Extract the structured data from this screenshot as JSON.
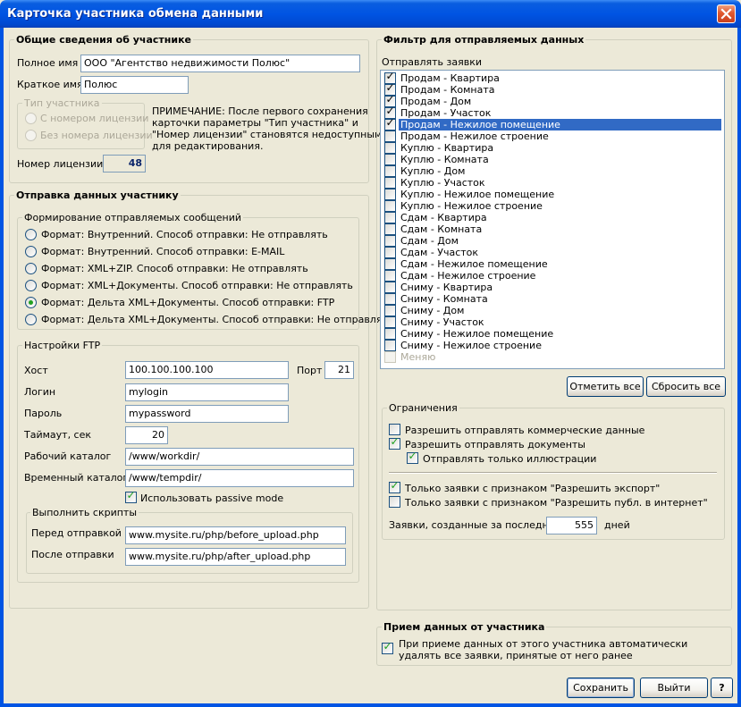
{
  "window": {
    "title": "Карточка участника обмена данными"
  },
  "general": {
    "title": "Общие сведения об участнике",
    "full_name_label": "Полное имя",
    "full_name_value": "ООО \"Агентство недвижимости Полюс\"",
    "short_name_label": "Краткое имя",
    "short_name_value": "Полюс",
    "type_group_title": "Тип участника",
    "type_options": [
      "С номером лицензии",
      "Без номера лицензии"
    ],
    "note": [
      "ПРИМЕЧАНИЕ: После первого сохранения",
      "карточки параметры \"Тип участника\" и",
      "\"Номер лицензии\" становятся недоступными",
      "для редактирования."
    ],
    "license_label": "Номер лицензии",
    "license_value": "48"
  },
  "send": {
    "title": "Отправка данных участнику",
    "formats_title": "Формирование отправляемых сообщений",
    "formats": [
      "Формат: Внутренний. Способ отправки: Не отправлять",
      "Формат: Внутренний. Способ отправки: E-MAIL",
      "Формат: XML+ZIP. Способ отправки: Не отправлять",
      "Формат: XML+Документы. Способ отправки: Не отправлять",
      "Формат: Дельта XML+Документы. Способ отправки: FTP",
      "Формат: Дельта XML+Документы. Способ отправки: Не отправлять"
    ],
    "selected_format": 4
  },
  "ftp": {
    "title": "Настройки FTP",
    "host_label": "Хост",
    "host_value": "100.100.100.100",
    "port_label": "Порт",
    "port_value": "21",
    "login_label": "Логин",
    "login_value": "mylogin",
    "password_label": "Пароль",
    "password_value": "mypassword",
    "timeout_label": "Таймаут, сек",
    "timeout_value": "20",
    "workdir_label": "Рабочий каталог",
    "workdir_value": "/www/workdir/",
    "tempdir_label": "Временный каталог",
    "tempdir_value": "/www/tempdir/",
    "passive_label": "Использовать passive mode",
    "passive_checked": true,
    "scripts_title": "Выполнить скрипты",
    "before_label": "Перед отправкой",
    "before_value": "www.mysite.ru/php/before_upload.php",
    "after_label": "После отправки",
    "after_value": "www.mysite.ru/php/after_upload.php"
  },
  "filter": {
    "title": "Фильтр для отправляемых данных",
    "list_label": "Отправлять заявки",
    "items": [
      {
        "label": "Продам - Квартира",
        "checked": true
      },
      {
        "label": "Продам - Комната",
        "checked": true
      },
      {
        "label": "Продам - Дом",
        "checked": true
      },
      {
        "label": "Продам - Участок",
        "checked": true
      },
      {
        "label": "Продам - Нежилое помещение",
        "checked": true
      },
      {
        "label": "Продам - Нежилое строение",
        "checked": false
      },
      {
        "label": "Куплю - Квартира",
        "checked": false
      },
      {
        "label": "Куплю - Комната",
        "checked": false
      },
      {
        "label": "Куплю - Дом",
        "checked": false
      },
      {
        "label": "Куплю - Участок",
        "checked": false
      },
      {
        "label": "Куплю - Нежилое помещение",
        "checked": false
      },
      {
        "label": "Куплю - Нежилое строение",
        "checked": false
      },
      {
        "label": "Сдам - Квартира",
        "checked": false
      },
      {
        "label": "Сдам - Комната",
        "checked": false
      },
      {
        "label": "Сдам - Дом",
        "checked": false
      },
      {
        "label": "Сдам - Участок",
        "checked": false
      },
      {
        "label": "Сдам - Нежилое помещение",
        "checked": false
      },
      {
        "label": "Сдам - Нежилое строение",
        "checked": false
      },
      {
        "label": "Сниму - Квартира",
        "checked": false
      },
      {
        "label": "Сниму - Комната",
        "checked": false
      },
      {
        "label": "Сниму - Дом",
        "checked": false
      },
      {
        "label": "Сниму - Участок",
        "checked": false
      },
      {
        "label": "Сниму - Нежилое помещение",
        "checked": false
      },
      {
        "label": "Сниму - Нежилое строение",
        "checked": false
      },
      {
        "label": "Меняю",
        "checked": false,
        "disabled": true
      }
    ],
    "selected_index": 4,
    "mark_all_label": "Отметить все",
    "reset_all_label": "Сбросить все"
  },
  "limits": {
    "title": "Ограничения",
    "allow_commercial": {
      "label": "Разрешить отправлять коммерческие данные",
      "checked": false
    },
    "allow_documents": {
      "label": "Разрешить отправлять документы",
      "checked": true
    },
    "only_illustrations": {
      "label": "Отправлять только иллюстрации",
      "checked": true
    },
    "only_export": {
      "label": "Только заявки с признаком \"Разрешить экспорт\"",
      "checked": true
    },
    "only_publish": {
      "label": "Только заявки с признаком \"Разрешить публ. в интернет\"",
      "checked": false
    },
    "recent_label": "Заявки, созданные за последние",
    "recent_value": "555",
    "recent_unit": "дней"
  },
  "receive": {
    "title": "Прием данных от участника",
    "auto_delete_lines": [
      "При приеме данных от этого участника автоматически",
      "удалять все заявки, принятые от него ранее"
    ],
    "auto_delete_checked": true
  },
  "footer": {
    "save_label": "Сохранить",
    "exit_label": "Выйти",
    "help_label": "?"
  }
}
